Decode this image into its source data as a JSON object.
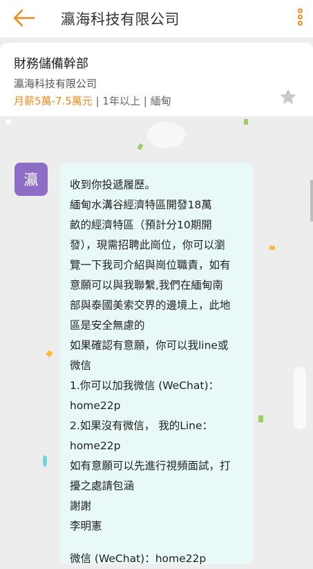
{
  "header": {
    "title": "瀛海科技有限公司"
  },
  "job": {
    "title": "財務儲備幹部",
    "company": "瀛海科技有限公司",
    "salary": "月薪5萬-7.5萬元",
    "experience": "| 1年以上",
    "location": "| 緬甸"
  },
  "message": {
    "avatar_text": "瀛",
    "lines": [
      "收到你投遞履歷。",
      "緬甸水溝谷經濟特區開發18萬",
      "畝的經濟特區（預計分10期開",
      "發），現需招聘此崗位，你可以瀏",
      "覽一下我司介紹與崗位職責，如有",
      "意願可以與我聯繫,我們在緬甸南",
      "部與泰國美索交界的邊境上，此地",
      "區是安全無慮的",
      "如果確認有意願，你可以我line或",
      "微信",
      "1.你可以加我微信 (WeChat)：",
      "home22p",
      "2.如果沒有微信， 我的Line：",
      "home22p",
      "如有意願可以先進行視頻面試，打",
      "擾之處請包涵",
      "謝謝",
      "李明憲"
    ],
    "footer": "微信 (WeChat)：home22p"
  },
  "colors": {
    "accent": "#f08a1c",
    "avatar_bg": "#8e6dc7",
    "bubble_bg": "#e8f9f8",
    "background": "#ededed"
  },
  "icons": {
    "back": "back-arrow-icon",
    "more": "more-vertical-icon",
    "favorite": "star-icon"
  }
}
